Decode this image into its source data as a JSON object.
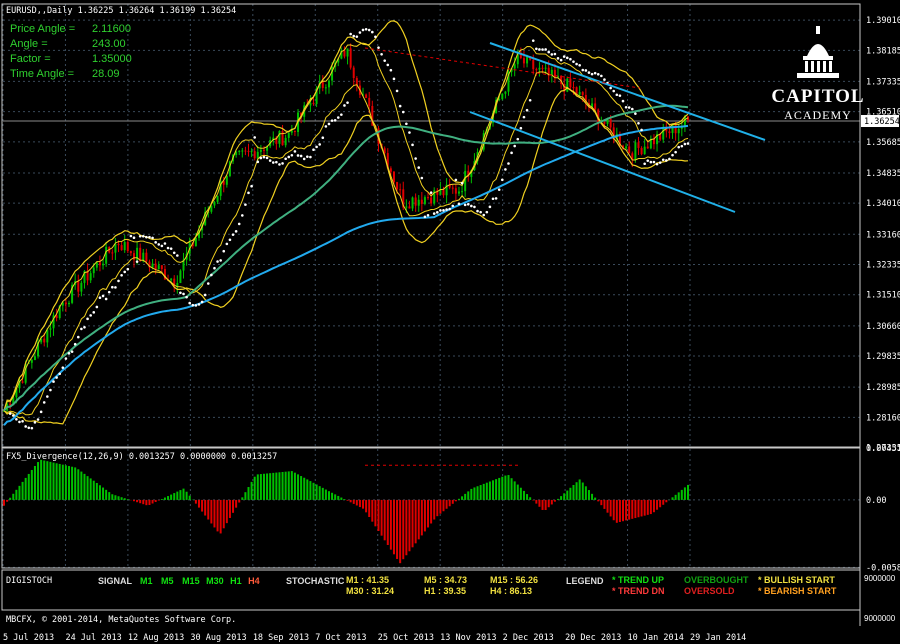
{
  "main_title": "EURUSD,,Daily  1.36225 1.36264 1.36199 1.36254",
  "angle_box": [
    {
      "label": "Price Angle =",
      "value": "2.11600"
    },
    {
      "label": "Angle =",
      "value": "243.00"
    },
    {
      "label": "Factor =",
      "value": "1.35000"
    },
    {
      "label": "Time Angle =",
      "value": "28.09"
    }
  ],
  "logo": {
    "line1": "CAPITOL",
    "line2": "ACADEMY"
  },
  "macd_title": "FX5_Divergence(12,26,9) 0.0013257 0.0000000 0.0013257",
  "digistoch": {
    "name": "DIGISTOCH",
    "signal_label": "SIGNAL",
    "timeframes": [
      "M1",
      "M5",
      "M15",
      "M30",
      "H1",
      "H4"
    ],
    "stochastic_label": "STOCHASTIC",
    "readings": [
      "M1 : 41.35",
      "M5 : 34.73",
      "M15 : 56.26",
      "M30 : 31.24",
      "H1 : 39.35",
      "H4 : 86.13"
    ],
    "legend_label": "LEGEND",
    "legend": [
      "* TREND UP",
      "* TREND DN",
      "OVERBOUGHT",
      "OVERSOLD",
      "* BULLISH START",
      "* BEARISH START"
    ],
    "scale_top": "9000000",
    "scale_bottom": "9000000"
  },
  "copyright": "MBCFX, © 2001-2014, MetaQuotes Software Corp.",
  "colors": {
    "bull": "#00c000",
    "bear": "#e00000",
    "bands": "#f0d020",
    "ma_slow": "#22aaee",
    "ma_mid": "#40b080",
    "psar": "#ffffff",
    "channel": "#20b0e8",
    "grid": "#3a4a5a"
  },
  "chart_data": [
    {
      "type": "candlestick",
      "symbol": "EURUSD",
      "timeframe": "Daily",
      "last_price": "1.36254",
      "price_tag": "1.36254",
      "ylim": [
        1.2735,
        1.3945
      ],
      "y_ticks": [
        "1.39010",
        "1.38185",
        "1.37335",
        "1.36510",
        "1.35685",
        "1.34835",
        "1.34010",
        "1.33160",
        "1.32335",
        "1.31510",
        "1.30660",
        "1.29835",
        "1.28985",
        "1.28160",
        "1.27335"
      ],
      "x_ticks": [
        "5 Jul 2013",
        "24 Jul 2013",
        "12 Aug 2013",
        "30 Aug 2013",
        "18 Sep 2013",
        "7 Oct 2013",
        "25 Oct 2013",
        "13 Nov 2013",
        "2 Dec 2013",
        "20 Dec 2013",
        "10 Jan 2014",
        "29 Jan 2014"
      ],
      "x": [
        "5 Jul 2013",
        "24 Jul 2013",
        "12 Aug 2013",
        "30 Aug 2013",
        "18 Sep 2013",
        "7 Oct 2013",
        "25 Oct 2013",
        "13 Nov 2013",
        "2 Dec 2013",
        "20 Dec 2013",
        "10 Jan 2014",
        "29 Jan 2014"
      ],
      "close_path": [
        1.2835,
        1.3125,
        1.3295,
        1.319,
        1.3515,
        1.359,
        1.382,
        1.3405,
        1.344,
        1.3795,
        1.371,
        1.354,
        1.3625
      ],
      "overlays": [
        "Bollinger bands",
        "Parabolic SAR",
        "Moving averages"
      ],
      "grid": true
    },
    {
      "type": "bar",
      "title": "FX5_Divergence(12,26,9)",
      "values_text": [
        "0.0013257",
        "0.0000000",
        "0.0013257"
      ],
      "ylim": [
        -0.0059,
        0.0045
      ],
      "y_ticks": [
        "0.004510",
        "0.00",
        "-0.005851"
      ],
      "histogram_path": [
        -0.0005,
        0.0035,
        0.0028,
        0.0005,
        -0.0005,
        0.001,
        -0.003,
        0.0022,
        0.0025,
        0.0008,
        -0.0008,
        -0.0055,
        -0.0015,
        0.001,
        0.0022,
        -0.001,
        0.0018,
        -0.002,
        -0.0012,
        0.0013
      ]
    }
  ]
}
